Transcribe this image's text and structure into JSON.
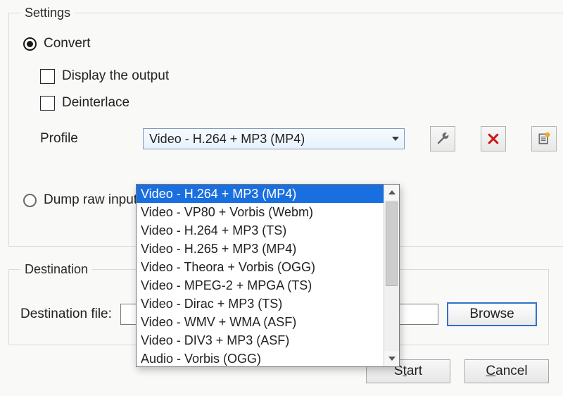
{
  "settings": {
    "legend": "Settings",
    "convert": {
      "label": "Convert",
      "checked": true
    },
    "display_output": {
      "label": "Display the output",
      "checked": false
    },
    "deinterlace": {
      "label": "Deinterlace",
      "checked": false
    },
    "profile_label": "Profile",
    "profile_selected": "Video - H.264 + MP3 (MP4)",
    "profile_options": [
      "Video - H.264 + MP3 (MP4)",
      "Video - VP80 + Vorbis (Webm)",
      "Video - H.264 + MP3 (TS)",
      "Video - H.265 + MP3 (MP4)",
      "Video - Theora + Vorbis (OGG)",
      "Video - MPEG-2 + MPGA (TS)",
      "Video - Dirac + MP3 (TS)",
      "Video - WMV + WMA (ASF)",
      "Video - DIV3 + MP3 (ASF)",
      "Audio - Vorbis (OGG)"
    ],
    "dump_raw": {
      "label": "Dump raw input",
      "checked": false
    },
    "icons": {
      "wrench": "wrench-icon",
      "delete": "delete-icon",
      "new_profile": "new-profile-icon"
    }
  },
  "destination": {
    "legend": "Destination",
    "file_label": "Destination file:",
    "file_value": "",
    "browse_label": "Browse"
  },
  "buttons": {
    "start_pre": "S",
    "start_u": "t",
    "start_post": "art",
    "cancel_pre": "",
    "cancel_u": "C",
    "cancel_post": "ancel"
  }
}
